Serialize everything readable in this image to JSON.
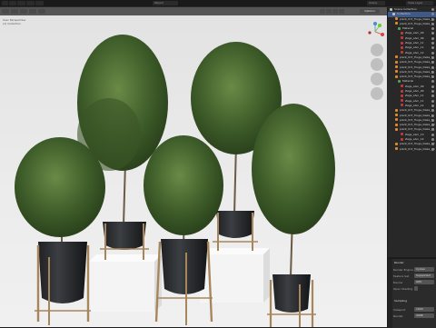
{
  "topbar": {
    "menu_items": [
      "",
      "",
      "",
      "",
      "",
      ""
    ],
    "mode": "Object",
    "view_layer": "View Layer",
    "scene": "Scene"
  },
  "viewport": {
    "header_left": "Options",
    "axis_labels": {
      "x": "X",
      "y": "Y",
      "z": "Z"
    },
    "overlay_text": [
      "User Perspective",
      "(1) Collection"
    ]
  },
  "outliner": {
    "rows": [
      {
        "label": "Scene Collection",
        "color": "#bdbdbd",
        "selected": false,
        "indent": 0
      },
      {
        "label": "Collection",
        "color": "#bdbdbd",
        "selected": true,
        "indent": 1
      },
      {
        "label": "plant_0r3_Tluga_Deka_0",
        "color": "#e28a2b",
        "selected": false,
        "indent": 2
      },
      {
        "label": "plant_0r3_Tluga_Deka_1",
        "color": "#e28a2b",
        "selected": false,
        "indent": 2
      },
      {
        "label": "Material",
        "color": "#4fa34f",
        "selected": false,
        "indent": 3
      },
      {
        "label": "Zags_alvn_09",
        "color": "#c23a3a",
        "selected": false,
        "indent": 4
      },
      {
        "label": "Zags_alvn_09",
        "color": "#c23a3a",
        "selected": false,
        "indent": 4
      },
      {
        "label": "Zags_alvn_11",
        "color": "#c23a3a",
        "selected": false,
        "indent": 4
      },
      {
        "label": "Zags_alvn_11",
        "color": "#c23a3a",
        "selected": false,
        "indent": 4
      },
      {
        "label": "Zags_alvn_12",
        "color": "#c23a3a",
        "selected": false,
        "indent": 4
      },
      {
        "label": "plant_0r3_Tluga_Deka_2",
        "color": "#e28a2b",
        "selected": false,
        "indent": 2
      },
      {
        "label": "plant_0r3_Tluga_Deka_3",
        "color": "#e28a2b",
        "selected": false,
        "indent": 2
      },
      {
        "label": "plant_0r3_Tluga_Deka_4",
        "color": "#e28a2b",
        "selected": false,
        "indent": 2
      },
      {
        "label": "plant_0r3_Tluga_Deka_5",
        "color": "#e28a2b",
        "selected": false,
        "indent": 2
      },
      {
        "label": "plant_0r3_Tluga_Deka_6",
        "color": "#e28a2b",
        "selected": false,
        "indent": 2
      },
      {
        "label": "Material",
        "color": "#4fa34f",
        "selected": false,
        "indent": 3
      },
      {
        "label": "Zags_alvn_09",
        "color": "#c23a3a",
        "selected": false,
        "indent": 4
      },
      {
        "label": "Zags_alvn_09",
        "color": "#c23a3a",
        "selected": false,
        "indent": 4
      },
      {
        "label": "Zags_alvn_11",
        "color": "#c23a3a",
        "selected": false,
        "indent": 4
      },
      {
        "label": "Zags_alvn_11",
        "color": "#c23a3a",
        "selected": false,
        "indent": 4
      },
      {
        "label": "Zags_alvn_12",
        "color": "#c23a3a",
        "selected": false,
        "indent": 4
      },
      {
        "label": "plant_0r3_Tluga_Deka_7",
        "color": "#e28a2b",
        "selected": false,
        "indent": 2
      },
      {
        "label": "plant_0r3_Tluga_Deka_8",
        "color": "#e28a2b",
        "selected": false,
        "indent": 2
      },
      {
        "label": "plant_0r3_Tluga_Deka_9",
        "color": "#e28a2b",
        "selected": false,
        "indent": 2
      },
      {
        "label": "plant_0r3_Tluga_Deka_10",
        "color": "#e28a2b",
        "selected": false,
        "indent": 2
      },
      {
        "label": "plant_0r3_Tluga_Deka_11",
        "color": "#e28a2b",
        "selected": false,
        "indent": 2
      },
      {
        "label": "Zags_alvn_13",
        "color": "#c23a3a",
        "selected": false,
        "indent": 4
      },
      {
        "label": "Zags_alvn_14",
        "color": "#c23a3a",
        "selected": false,
        "indent": 4
      },
      {
        "label": "plant_0r3_Tluga_Deka_12",
        "color": "#e28a2b",
        "selected": false,
        "indent": 2
      },
      {
        "label": "plant_0r3_Tluga_Deka_13",
        "color": "#e28a2b",
        "selected": false,
        "indent": 2
      }
    ]
  },
  "properties": {
    "section_title": "Render",
    "fields": [
      {
        "label": "Render Engine",
        "value": "Cycles"
      },
      {
        "label": "Feature Set",
        "value": "Supported"
      },
      {
        "label": "Device",
        "value": "GPU"
      },
      {
        "label": "Open Shading",
        "value": ""
      }
    ],
    "sampling_title": "Sampling",
    "sampling_fields": [
      {
        "label": "Viewport",
        "value": "1024"
      },
      {
        "label": "Render",
        "value": "4096"
      }
    ]
  },
  "scene": {
    "plants": [
      {
        "name": "plant-left"
      },
      {
        "name": "plant-tall-left"
      },
      {
        "name": "plant-center"
      },
      {
        "name": "plant-tall-right"
      },
      {
        "name": "plant-right"
      }
    ]
  }
}
